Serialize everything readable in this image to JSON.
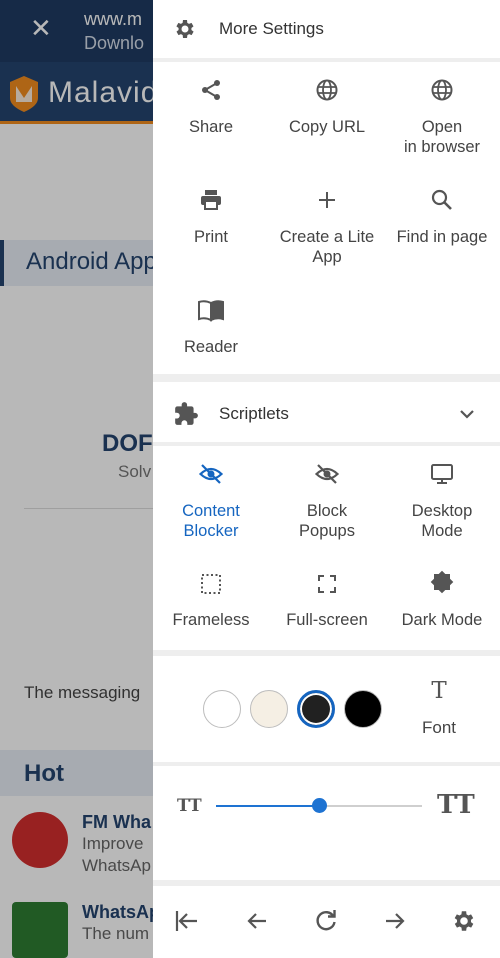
{
  "background_page": {
    "url_line1": "www.m",
    "url_line2": "Downlo",
    "logo_text": "Malavid",
    "section_title": "Android App",
    "app_heading": "DOF",
    "app_sub": "Solv",
    "message_text": "The messaging",
    "hot_title": "Hot",
    "rows": [
      {
        "title": "FM Wha",
        "sub1": "Improve",
        "sub2": "WhatsAp"
      },
      {
        "title": "WhatsAp",
        "sub1": "The num",
        "sub2": ""
      }
    ]
  },
  "drawer": {
    "header": {
      "title": "More Settings",
      "icon": "gear-icon"
    },
    "actions": [
      {
        "label": "Share",
        "icon": "share-icon"
      },
      {
        "label": "Copy URL",
        "icon": "globe-icon"
      },
      {
        "label": "Open in browser",
        "icon": "globe-icon"
      },
      {
        "label": "Print",
        "icon": "printer-icon"
      },
      {
        "label": "Create a Lite App",
        "icon": "plus-icon"
      },
      {
        "label": "Find in page",
        "icon": "search-icon"
      },
      {
        "label": "Reader",
        "icon": "book-icon"
      }
    ],
    "scriptlets": {
      "title": "Scriptlets",
      "icon": "puzzle-icon",
      "expanded": false
    },
    "modes": [
      {
        "label": "Content Blocker",
        "icon": "eye-off-icon",
        "active": true
      },
      {
        "label": "Block Popups",
        "icon": "eye-off-icon",
        "active": false
      },
      {
        "label": "Desktop Mode",
        "icon": "monitor-icon",
        "active": false
      },
      {
        "label": "Frameless",
        "icon": "frameless-icon",
        "active": false
      },
      {
        "label": "Full-screen",
        "icon": "fullscreen-icon",
        "active": false
      },
      {
        "label": "Dark Mode",
        "icon": "dark-mode-icon",
        "active": false
      }
    ],
    "themes": {
      "swatches": [
        {
          "name": "white",
          "color": "#ffffff",
          "selected": false
        },
        {
          "name": "sepia",
          "color": "#f5efe4",
          "selected": false
        },
        {
          "name": "dark-gray",
          "color": "#212121",
          "selected": true
        },
        {
          "name": "black",
          "color": "#000000",
          "selected": false
        }
      ],
      "font_label": "Font",
      "font_icon_text": "T"
    },
    "text_size": {
      "small_icon_text": "TT",
      "large_icon_text": "TT",
      "value_fraction": 0.5
    },
    "bottom_nav": [
      {
        "name": "first-icon"
      },
      {
        "name": "back-icon"
      },
      {
        "name": "reload-icon"
      },
      {
        "name": "forward-icon"
      },
      {
        "name": "settings-icon"
      }
    ]
  },
  "colors": {
    "accent": "#1565c0",
    "drawer_bg": "#eeeeee",
    "icon": "#555555",
    "header_bar": "#1f3b63",
    "brand_orange": "#f28c1f"
  }
}
